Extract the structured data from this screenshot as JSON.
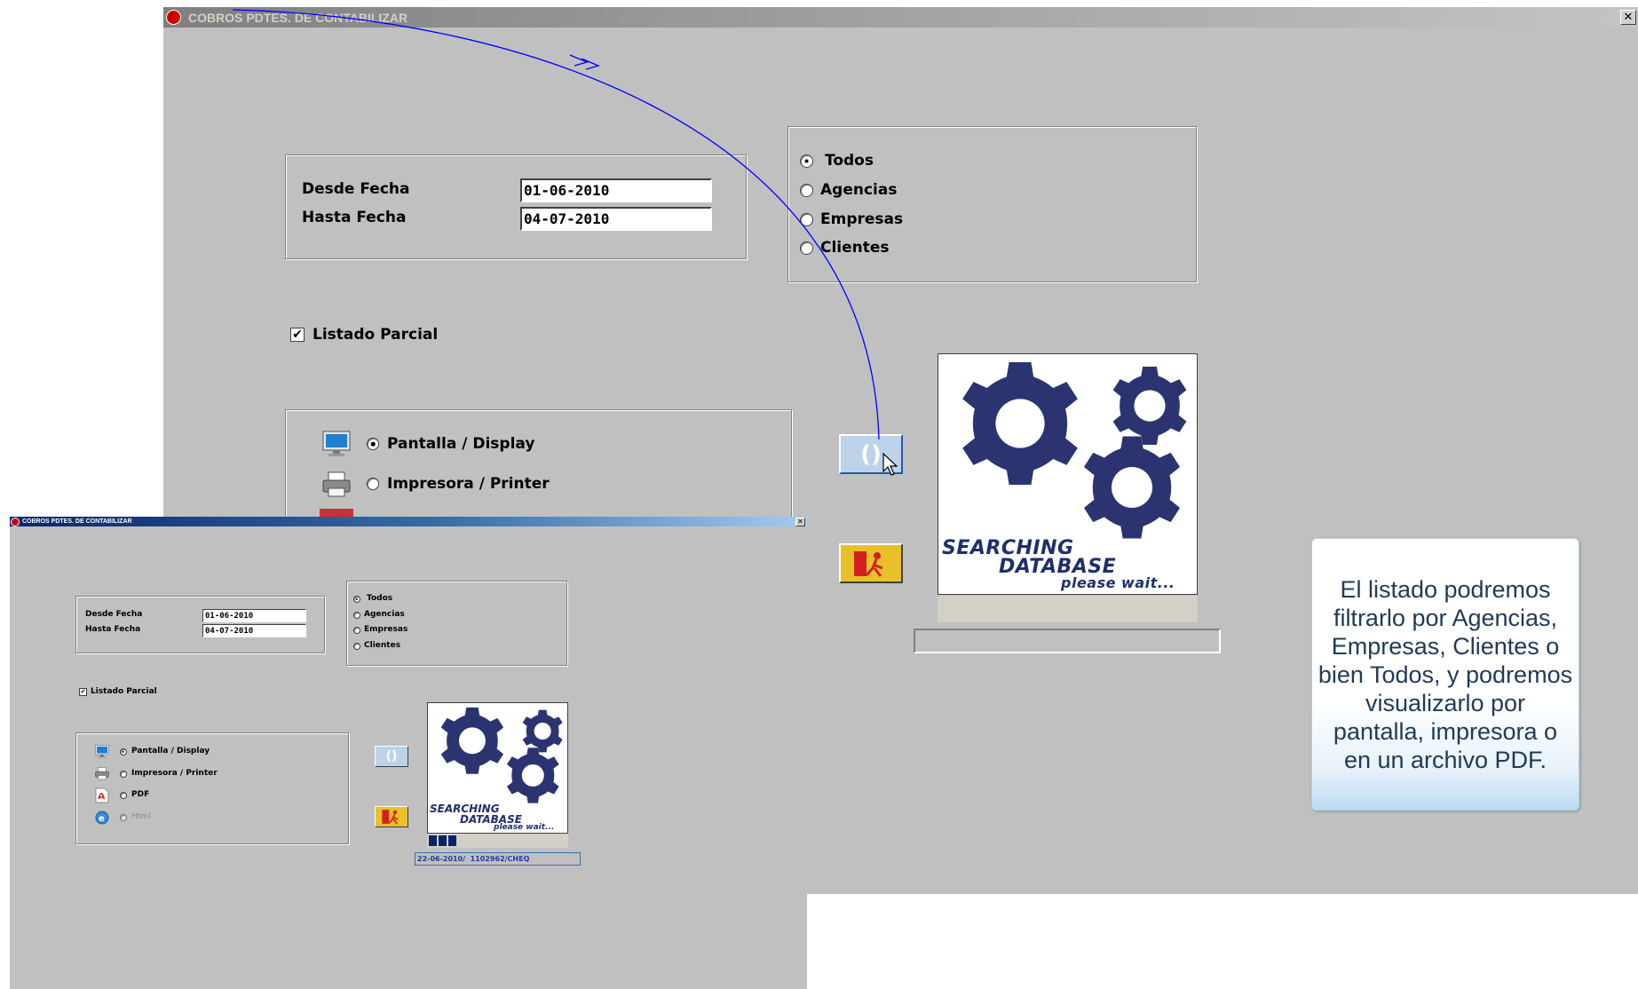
{
  "main_window": {
    "title": "COBROS  PDTES. DE CONTABILIZAR",
    "close_symbol": "✕",
    "date_range": {
      "desde_label": "Desde  Fecha",
      "desde_value": "01-06-2010",
      "hasta_label": "Hasta  Fecha",
      "hasta_value": "04-07-2010"
    },
    "filter": {
      "options": [
        "Todos",
        "Agencias",
        "Empresas",
        "Clientes"
      ],
      "selected": "Todos"
    },
    "listado_parcial": {
      "label": "Listado Parcial",
      "checked": true
    },
    "output": {
      "options": [
        "Pantalla / Display",
        "Impresora / Printer"
      ],
      "selected": "Pantalla / Display"
    },
    "searching": {
      "line1": "SEARCHING",
      "line2": "DATABASE",
      "line3": "please wait..."
    }
  },
  "small_window": {
    "title": "COBROS  PDTES. DE CONTABILIZAR",
    "close_symbol": "✕",
    "date_range": {
      "desde_label": "Desde  Fecha",
      "desde_value": "01-06-2010",
      "hasta_label": "Hasta  Fecha",
      "hasta_value": "04-07-2010"
    },
    "filter": {
      "options": [
        "Todos",
        "Agencias",
        "Empresas",
        "Clientes"
      ],
      "selected": "Todos"
    },
    "listado_parcial": {
      "label": "Listado Parcial",
      "checked": true
    },
    "output": {
      "options": [
        "Pantalla / Display",
        "Impresora / Printer",
        "PDF",
        "Html"
      ],
      "selected": "Pantalla / Display",
      "disabled": [
        "Html"
      ]
    },
    "searching": {
      "line1": "SEARCHING",
      "line2": "DATABASE",
      "line3": "please wait..."
    },
    "status_text": "22-06-2010/  1102962/CHEQ",
    "progress_blocks": 3
  },
  "callout": {
    "text": "El listado podremos filtrarlo por Agencias, Empresas, Clientes o bien Todos, y podremos visualizarlo por pantalla, impresora o en un archivo PDF."
  },
  "colors": {
    "window_bg": "#c0c0c0",
    "gear_blue": "#2b3470",
    "annotation_line": "#0000ff",
    "exit_button": "#e8c12a",
    "callout_text": "#223a57"
  },
  "icons": {
    "refresh": "refresh-icon",
    "exit": "exit-door-icon",
    "display": "monitor-icon",
    "printer": "printer-icon",
    "pdf": "pdf-icon",
    "html": "html-icon",
    "gears": "gears-icon",
    "app": "app-logo-icon",
    "cursor": "mouse-cursor-icon"
  }
}
